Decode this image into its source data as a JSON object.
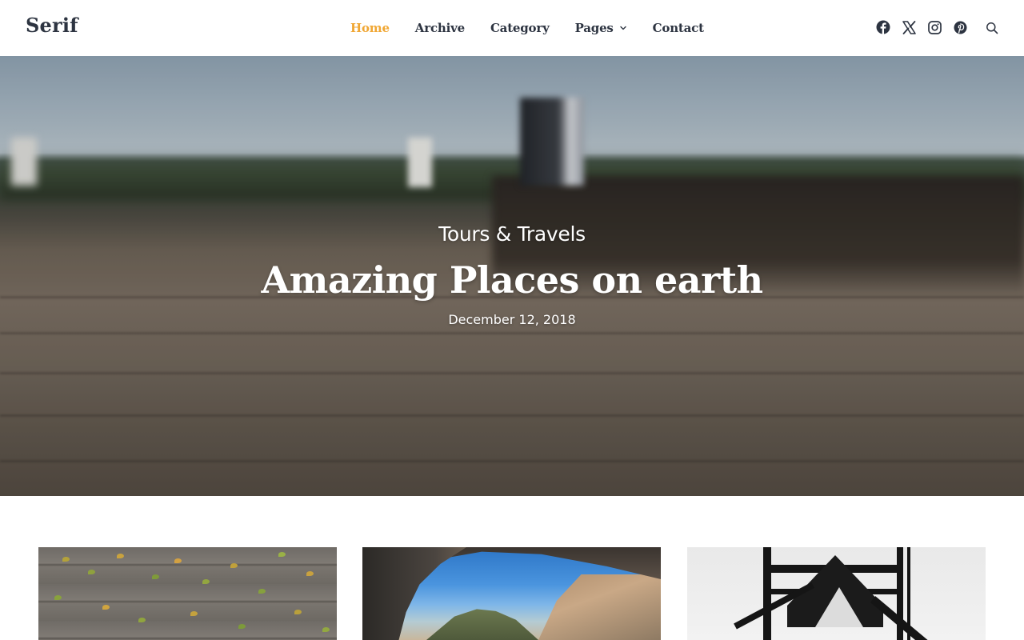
{
  "site": {
    "logo": "Serif"
  },
  "nav": {
    "items": [
      {
        "label": "Home",
        "active": true
      },
      {
        "label": "Archive",
        "active": false
      },
      {
        "label": "Category",
        "active": false
      },
      {
        "label": "Pages",
        "active": false,
        "has_dropdown": true
      },
      {
        "label": "Contact",
        "active": false
      }
    ]
  },
  "social": {
    "icons": [
      "facebook-icon",
      "x-twitter-icon",
      "instagram-icon",
      "pinterest-icon"
    ]
  },
  "search": {
    "icon": "search-icon"
  },
  "hero": {
    "category": "Tours & Travels",
    "title": "Amazing Places on earth",
    "date": "December 12, 2018"
  },
  "colors": {
    "accent": "#f0a734",
    "nav_text": "#2d3441",
    "hero_text": "#ffffff"
  },
  "cards": [
    {
      "image": "wooden-planks-with-leaves"
    },
    {
      "image": "rock-arch-mountain-view"
    },
    {
      "image": "black-steel-structure"
    }
  ]
}
